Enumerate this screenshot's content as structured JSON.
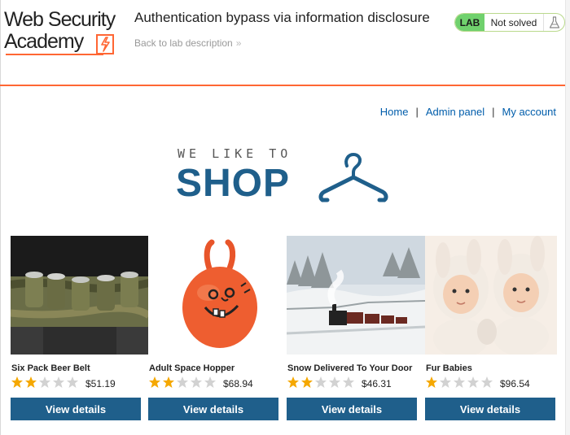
{
  "header": {
    "logo_line1": "Web Security",
    "logo_line2": "Academy",
    "lab_title": "Authentication bypass via information disclosure",
    "back_link": "Back to lab description",
    "status": {
      "badge": "LAB",
      "text": "Not solved",
      "icon": "flask-icon"
    }
  },
  "nav": {
    "items": [
      {
        "label": "Home"
      },
      {
        "label": "Admin panel"
      },
      {
        "label": "My account"
      }
    ],
    "separator": "|"
  },
  "banner": {
    "tagline": "WE LIKE TO",
    "word": "SHOP"
  },
  "products": [
    {
      "name": "Six Pack Beer Belt",
      "rating": 2,
      "max_rating": 5,
      "price": "$51.19",
      "button": "View details"
    },
    {
      "name": "Adult Space Hopper",
      "rating": 2,
      "max_rating": 5,
      "price": "$68.94",
      "button": "View details"
    },
    {
      "name": "Snow Delivered To Your Door",
      "rating": 2,
      "max_rating": 5,
      "price": "$46.31",
      "button": "View details"
    },
    {
      "name": "Fur Babies",
      "rating": 1,
      "max_rating": 5,
      "price": "$96.54",
      "button": "View details"
    }
  ],
  "colors": {
    "accent": "#ff6633",
    "brand_blue": "#1f5f8b",
    "link": "#005dab",
    "status_green": "#70d16d",
    "star_filled": "#f5a800",
    "star_empty": "#cccccc"
  }
}
